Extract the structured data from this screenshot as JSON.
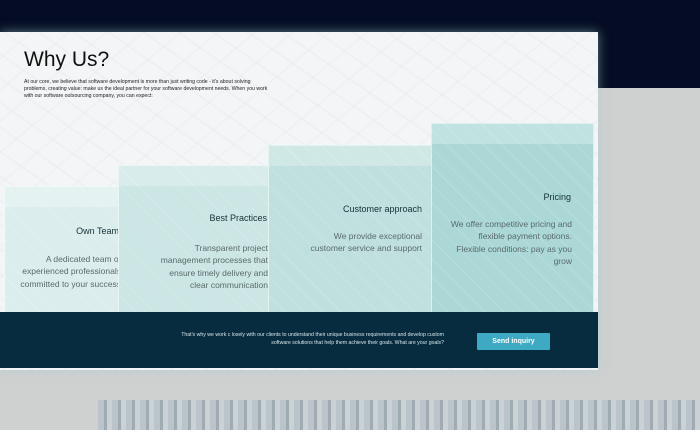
{
  "heading": "Why Us?",
  "intro": "At our core, we believe that software development is more than just writing code - it's about solving problems, creating value: make us the ideal partner for your software development needs. When you work with our software outsourcing company, you can expect:",
  "cards": [
    {
      "title": "Own Team",
      "text": "A dedicated team of experienced professionals committed to your success"
    },
    {
      "title": "Best Practices",
      "text": "Transparent project management processes that ensure timely delivery and clear communication"
    },
    {
      "title": "Customer approach",
      "text": "We provide exceptional customer service and support"
    },
    {
      "title": "Pricing",
      "text": "We offer competitive pricing and flexible payment options. Flexible conditions: pay as you grow"
    }
  ],
  "footer": {
    "text": "That's why we work c losely with our clients to understand their unique business requirements and develop custom software solutions that help them achieve their goals. What are your goals?",
    "button": "Send inquiry"
  },
  "colors": {
    "accent": "#3ea9c2",
    "footer_bg": "#072c3f",
    "top_band": "#050d24"
  }
}
